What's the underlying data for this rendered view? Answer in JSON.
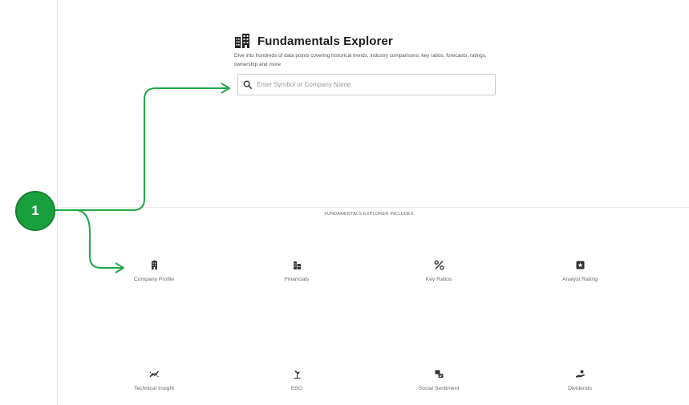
{
  "header": {
    "title": "Fundamentals Explorer",
    "subtitle": "Dive into hundreds of data points covering historical trends, industry comparisons, key ratios, forecasts, ratings, ownership and more"
  },
  "search": {
    "placeholder": "Enter Symbol or Company Name"
  },
  "includes_heading": "FUNDAMENTALS EXPLORER INCLUDES",
  "features": [
    {
      "label": "Company Profile",
      "icon": "building-icon"
    },
    {
      "label": "Financials",
      "icon": "coins-icon"
    },
    {
      "label": "Key Ratios",
      "icon": "percent-icon"
    },
    {
      "label": "Analyst Rating",
      "icon": "star-square-icon"
    },
    {
      "label": "Technical Insight",
      "icon": "trend-line-icon"
    },
    {
      "label": "ESG",
      "icon": "plant-icon"
    },
    {
      "label": "Social Sentiment",
      "icon": "chat-icon"
    },
    {
      "label": "Dividends",
      "icon": "hand-coin-icon"
    }
  ],
  "annotation": {
    "callout_number": "1",
    "color": "#1a9f3e"
  }
}
